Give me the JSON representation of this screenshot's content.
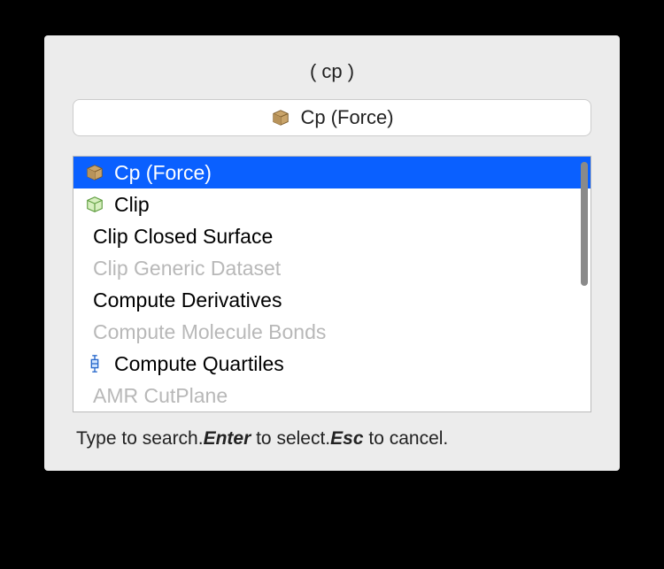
{
  "query": "( cp )",
  "input": {
    "icon": "box",
    "value": "Cp (Force)"
  },
  "items": [
    {
      "icon": "box",
      "label": "Cp (Force)",
      "state": "selected"
    },
    {
      "icon": "greenbox",
      "label": "Clip",
      "state": "normal"
    },
    {
      "icon": "",
      "label": "Clip Closed Surface",
      "state": "normal"
    },
    {
      "icon": "",
      "label": "Clip Generic Dataset",
      "state": "disabled"
    },
    {
      "icon": "",
      "label": "Compute Derivatives",
      "state": "normal"
    },
    {
      "icon": "",
      "label": "Compute Molecule Bonds",
      "state": "disabled"
    },
    {
      "icon": "quartile",
      "label": "Compute Quartiles",
      "state": "normal"
    },
    {
      "icon": "",
      "label": "AMR CutPlane",
      "state": "disabled"
    }
  ],
  "hint": {
    "p1": "Type to search.",
    "k1": "Enter",
    "p2": " to select.",
    "k2": "Esc",
    "p3": " to cancel."
  }
}
